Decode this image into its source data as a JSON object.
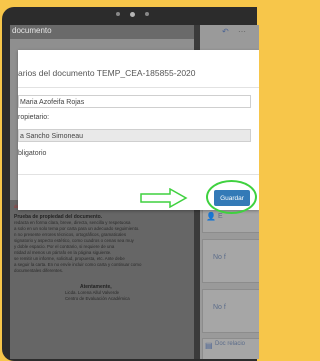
{
  "background_doc": {
    "title": "documento",
    "lines": [
      {
        "text": "de sellos (Seleccionar la opción correcta y firmar la",
        "style": "red"
      },
      {
        "text": "Prueba de propiedad del documento.",
        "style": "bold"
      },
      {
        "text": "redacta en forma clara, breve, directa, sencilla y respetuosa",
        "style": "normal"
      },
      {
        "text": "a solo en un solo tema por carta para un adecuado seguimiento.",
        "style": "normal"
      },
      {
        "text": "n no presente errores técnicos, ortográficos, gramaticales",
        "style": "normal"
      },
      {
        "text": "signatorio y aspecto estético, como cuadros o cenas sea muy",
        "style": "normal"
      },
      {
        "text": "y doble espacio. Por el contrario, si requiere de una",
        "style": "normal"
      },
      {
        "text": "ntidad al menos un párrafo en la página siguiente.",
        "style": "normal"
      },
      {
        "text": "se remitir un informe, solicitud, propuesta, etc. Ante debe",
        "style": "normal"
      },
      {
        "text": "a seguir la carta. En no envíe incluir como carta y continuar como",
        "style": "normal"
      },
      {
        "text": "documentales diferentes.",
        "style": "normal"
      },
      {
        "text": "Atentamente,",
        "style": "bold"
      },
      {
        "text": "Licda.     Lorena     Allul     Valverde",
        "style": "normal"
      },
      {
        "text": "Centro de Evaluación Académica",
        "style": "normal"
      }
    ]
  },
  "right_panel": {
    "cards": [
      {
        "label": "E",
        "icon": "user-icon"
      },
      {
        "label": "No f",
        "icon": ""
      },
      {
        "label": "No f",
        "icon": ""
      },
      {
        "label": "Doc relacio",
        "icon": "document-icon"
      },
      {
        "label": "No f",
        "icon": ""
      }
    ]
  },
  "modal": {
    "title": "arios del documento TEMP_CEA-185855-2020",
    "signer_value": "Maria Azofeifa Rojas",
    "owner_label": "ropietario:",
    "owner_value": "a Sancho Simoneau",
    "required_label": "bligatorio",
    "save_label": "Guardar"
  },
  "colors": {
    "save_button": "#337ab7",
    "highlight_ring": "#3fd13f",
    "arrow": "#3fd13f",
    "device_background": "#f7c64a"
  }
}
